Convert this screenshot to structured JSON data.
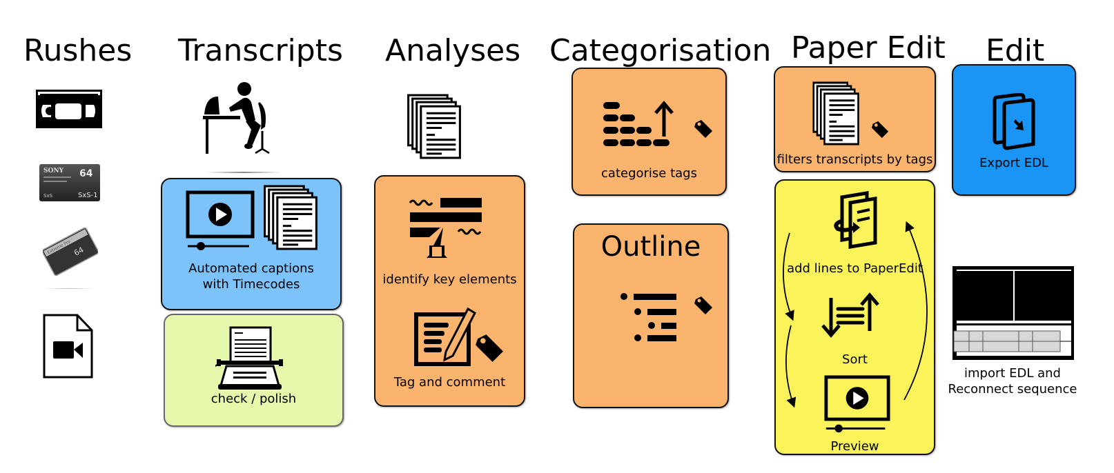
{
  "colors": {
    "light_blue": "#7cc2fb",
    "light_green": "#e5f8ac",
    "orange": "#fbb46d",
    "yellow": "#fbf35a",
    "blue": "#1a94f5"
  },
  "columns": {
    "rushes": {
      "title": "Rushes",
      "icons": [
        "vhs-tape-icon",
        "sxs-card-icon",
        "compact-flash-card-icon",
        "video-file-icon"
      ],
      "sxs_card_text": {
        "brand": "SONY",
        "capacity": "64",
        "model": "SxS-1",
        "series": "SxS"
      },
      "cf_card_text": {
        "brand": "Extreme Pro",
        "capacity": "64"
      }
    },
    "transcripts": {
      "title": "Transcripts",
      "boxes": [
        {
          "label_line1": "Automated captions",
          "label_line2": "with Timecodes",
          "icons": [
            "video-player-icon",
            "documents-stack-icon"
          ]
        },
        {
          "label": "check / polish",
          "icons": [
            "typewriter-icon"
          ]
        }
      ]
    },
    "analyses": {
      "title": "Analyses",
      "boxes": [
        {
          "label": "identify key elements",
          "icons": [
            "highlighter-text-icon"
          ]
        },
        {
          "label": "Tag and comment",
          "icons": [
            "edit-document-icon",
            "tag-icon"
          ]
        }
      ]
    },
    "categorisation": {
      "title": "Categorisation",
      "boxes": [
        {
          "label": "categorise tags",
          "icons": [
            "sort-blocks-icon",
            "tag-icon"
          ]
        },
        {
          "title": "Outline",
          "icons": [
            "outline-list-icon",
            "tag-icon"
          ]
        }
      ]
    },
    "paper_edit": {
      "title": "Paper Edit",
      "boxes": [
        {
          "label": "filters transcripts by tags",
          "icons": [
            "documents-stack-icon",
            "tag-icon"
          ]
        },
        {
          "steps": [
            {
              "label": "add lines to PaperEdit",
              "icon": "add-to-document-icon"
            },
            {
              "label": "Sort",
              "icon": "sort-icon"
            },
            {
              "label": "Preview",
              "icon": "video-player-icon"
            }
          ]
        }
      ]
    },
    "edit": {
      "title": "Edit",
      "boxes": [
        {
          "label": "Export EDL",
          "icons": [
            "export-document-icon"
          ]
        }
      ],
      "import_label_line1": "import EDL and",
      "import_label_line2": "Reconnect sequence",
      "import_icon": "editor-timeline-icon"
    }
  }
}
